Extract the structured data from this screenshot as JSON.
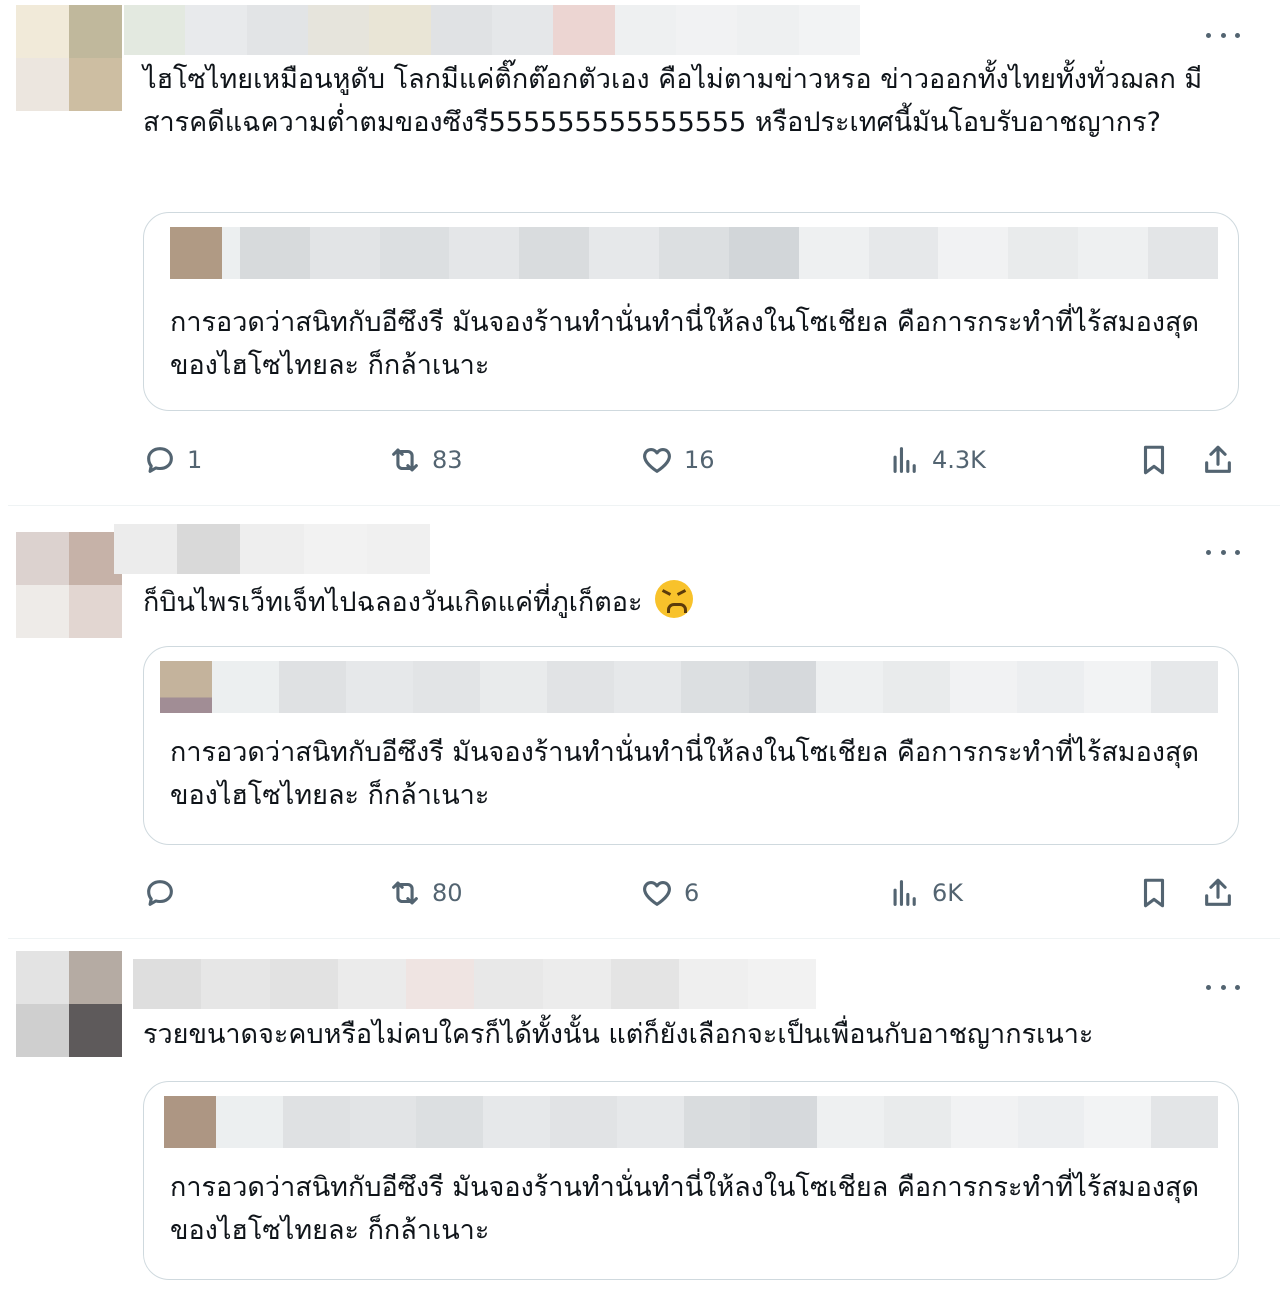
{
  "tweets": [
    {
      "text": "ไฮโซไทยเหมือนหูดับ โลกมีแค่ติ๊กต๊อกตัวเอง คือไม่ตามข่าวหรอ ข่าวออกทั้งไทยทั้งทั่วฌลก มีสารคดีแฉความต่ำตมของซึงรี555555555555555 หรือประเทศนี้มันโอบรับอาชญากร?",
      "quote": {
        "text": "การอวดว่าสนิทกับอีซึงรี มันจองร้านทำนั่นทำนี่ให้ลงในโซเชียล คือการกระทำที่ไร้สมองสุดของไฮโซไทยละ ก็กล้าเนาะ"
      },
      "stats": {
        "replies": "1",
        "reposts": "83",
        "likes": "16",
        "views": "4.3K"
      }
    },
    {
      "text": "ก็บินไพรเว็ทเจ็ทไปฉลองวันเกิดแค่ที่ภูเก็ตอะ",
      "emoji": "tired-face-emoji",
      "quote": {
        "text": "การอวดว่าสนิทกับอีซึงรี มันจองร้านทำนั่นทำนี่ให้ลงในโซเชียล คือการกระทำที่ไร้สมองสุดของไฮโซไทยละ ก็กล้าเนาะ"
      },
      "stats": {
        "replies": "",
        "reposts": "80",
        "likes": "6",
        "views": "6K"
      }
    },
    {
      "text": "รวยขนาดจะคบหรือไม่คบใครก็ได้ทั้งนั้น แต่ก็ยังเลือกจะเป็นเพื่อนกับอาชญากรเนาะ",
      "quote": {
        "text": "การอวดว่าสนิทกับอีซึงรี มันจองร้านทำนั่นทำนี่ให้ลงในโซเชียล คือการกระทำที่ไร้สมองสุดของไฮโซไทยละ ก็กล้าเนาะ"
      }
    }
  ],
  "icons": {
    "reply": "reply-icon",
    "repost": "repost-icon",
    "like": "heart-icon",
    "views": "views-icon",
    "bookmark": "bookmark-icon",
    "share": "share-icon",
    "more": "more-icon"
  },
  "colors": {
    "text": "#0f1419",
    "secondary": "#536471",
    "border": "#cfd9de"
  }
}
